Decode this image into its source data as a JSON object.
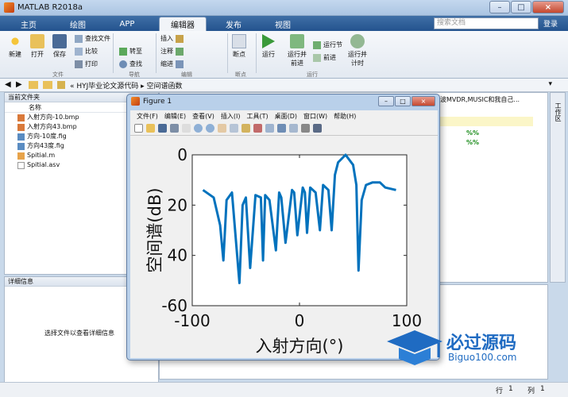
{
  "app": {
    "title": "MATLAB R2018a"
  },
  "tabs": [
    "主页",
    "绘图",
    "APP",
    "编辑器",
    "发布",
    "视图"
  ],
  "search": {
    "placeholder": "搜索文档",
    "login": "登录"
  },
  "ribbon": {
    "new": "新建",
    "open": "打开",
    "save": "保存",
    "find_files": "查找文件",
    "compare": "比较",
    "print": "打印",
    "goto": "转至",
    "find": "查找",
    "insert": "插入",
    "comment": "注释",
    "indent": "缩进",
    "breakpoints": "断点",
    "run": "运行",
    "run_advance": "运行并\n前进",
    "run_section": "运行节",
    "advance": "前进",
    "run_time": "运行并\n计时",
    "group_file": "文件",
    "group_nav": "导航",
    "group_edit": "编辑",
    "group_bp": "断点",
    "group_run": "运行"
  },
  "address": {
    "path": "« HYJ毕业论文源代码 ▸ 空间谱函数"
  },
  "folder": {
    "title": "当前文件夹",
    "column": "名称",
    "files": [
      "入射方向-10.bmp",
      "入射方向43.bmp",
      "方向-10度.fig",
      "方向43度.fig",
      "Spitial.m",
      "Spitial.asv"
    ]
  },
  "details": {
    "title": "详细信息",
    "message": "选择文件以查看详细信息"
  },
  "editor": {
    "tab": "波MVDR,MUSIC和我自己...",
    "pct1": "%%",
    "pct2": "%%"
  },
  "workspace": {
    "label": "工作区"
  },
  "status": {
    "row_label": "行",
    "row": "1",
    "col_label": "列",
    "col": "1"
  },
  "figure": {
    "title": "Figure 1",
    "menu": [
      "文件(F)",
      "编辑(E)",
      "查看(V)",
      "插入(I)",
      "工具(T)",
      "桌面(D)",
      "窗口(W)",
      "帮助(H)"
    ]
  },
  "chart_data": {
    "type": "line",
    "xlabel": "入射方向(°)",
    "ylabel": "空间谱(dB)",
    "xlim": [
      -100,
      100
    ],
    "ylim": [
      -60,
      0
    ],
    "yticks": [
      0,
      -20,
      -40,
      -60
    ],
    "yticklabels": [
      "0",
      "20",
      "40",
      "-60"
    ],
    "xticks": [
      -100,
      0,
      100
    ],
    "xticklabels": [
      "-100",
      "0",
      "100"
    ],
    "grid": false,
    "color": "#0072bd",
    "series": [
      {
        "x": [
          -90,
          -80,
          -74,
          -71,
          -68,
          -63,
          -56,
          -53,
          -50,
          -46,
          -41,
          -36,
          -34,
          -32,
          -28,
          -22,
          -19,
          -17,
          -13,
          -7,
          -5,
          -2,
          3,
          5,
          7,
          10,
          15,
          19,
          22,
          27,
          30,
          33,
          36,
          43,
          50,
          53,
          55,
          58,
          62,
          68,
          75,
          80,
          90
        ],
        "y": [
          -14,
          -17,
          -28,
          -42,
          -18,
          -15,
          -51,
          -20,
          -17,
          -45,
          -16,
          -17,
          -42,
          -16,
          -18,
          -38,
          -15,
          -17,
          -35,
          -14,
          -15,
          -32,
          -13,
          -15,
          -31,
          -13,
          -15,
          -30,
          -12,
          -14,
          -30,
          -8,
          -3,
          0,
          -4,
          -12,
          -46,
          -18,
          -12,
          -11,
          -11,
          -13,
          -14
        ]
      }
    ]
  }
}
